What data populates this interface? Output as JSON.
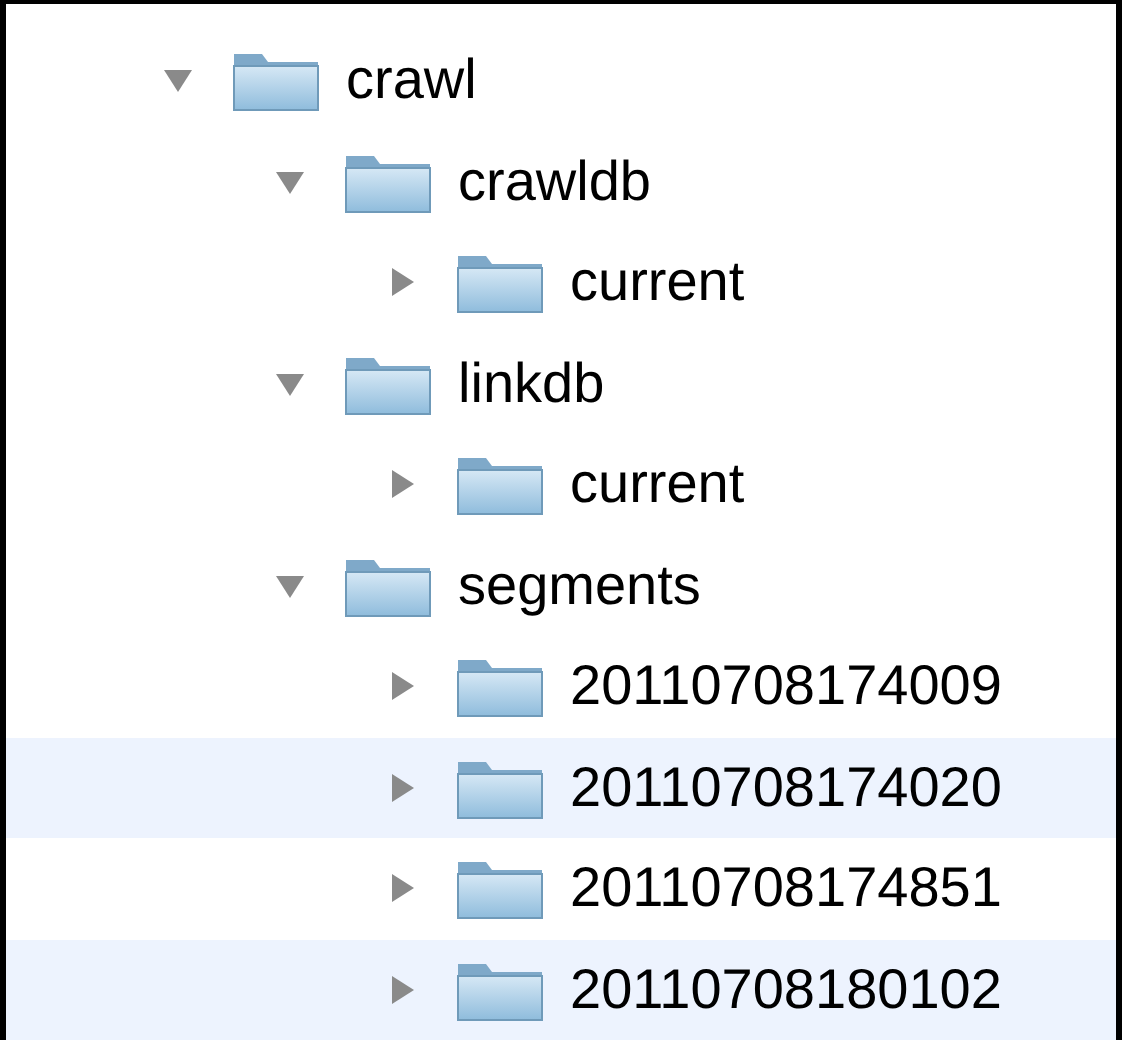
{
  "tree": [
    {
      "label": "crawl",
      "expanded": true,
      "children": [
        {
          "label": "crawldb",
          "expanded": true,
          "children": [
            {
              "label": "current",
              "expanded": false
            }
          ]
        },
        {
          "label": "linkdb",
          "expanded": true,
          "children": [
            {
              "label": "current",
              "expanded": false
            }
          ]
        },
        {
          "label": "segments",
          "expanded": true,
          "children": [
            {
              "label": "20110708174009",
              "expanded": false
            },
            {
              "label": "20110708174020",
              "expanded": false
            },
            {
              "label": "20110708174851",
              "expanded": false
            },
            {
              "label": "20110708180102",
              "expanded": false
            }
          ]
        }
      ]
    }
  ]
}
